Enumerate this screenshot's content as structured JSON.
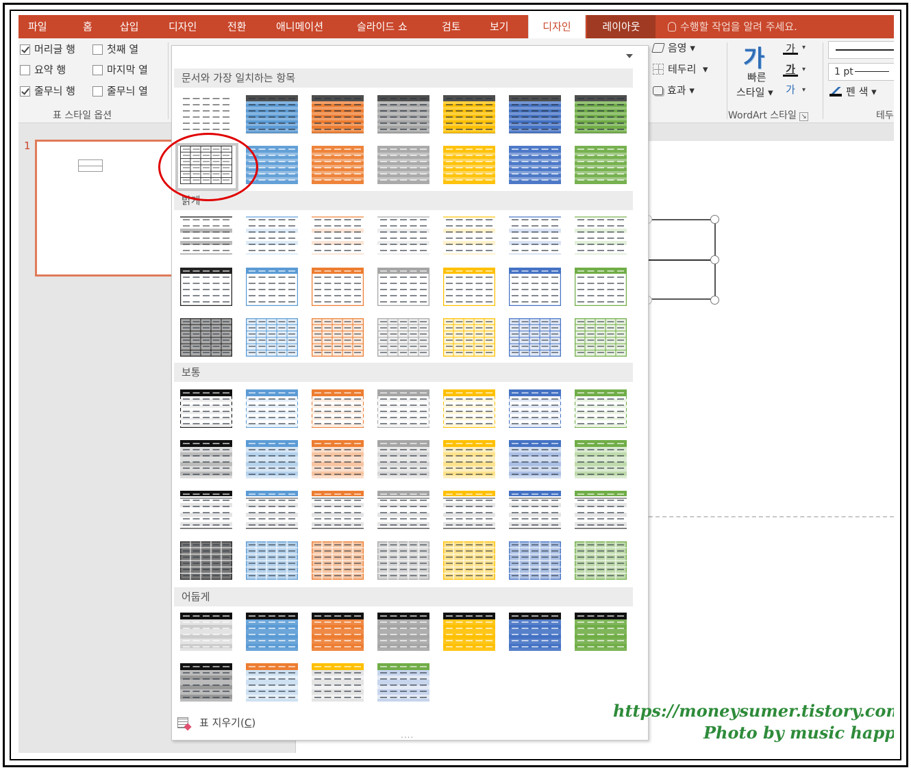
{
  "tabs": [
    {
      "label": "파일"
    },
    {
      "label": "홈"
    },
    {
      "label": "삽입"
    },
    {
      "label": "디자인"
    },
    {
      "label": "전환"
    },
    {
      "label": "애니메이션"
    },
    {
      "label": "슬라이드 쇼"
    },
    {
      "label": "검토"
    },
    {
      "label": "보기"
    },
    {
      "label": "디자인"
    },
    {
      "label": "레이아웃"
    }
  ],
  "tell_me": "수행할 작업을 알려 주세요.",
  "style_options": {
    "group_label": "표 스타일 옵션",
    "items": [
      {
        "label": "머리글 행",
        "checked": true
      },
      {
        "label": "첫째 열",
        "checked": false
      },
      {
        "label": "요약 행",
        "checked": false
      },
      {
        "label": "마지막 열",
        "checked": false
      },
      {
        "label": "줄무늬 행",
        "checked": true
      },
      {
        "label": "줄무늬 열",
        "checked": false
      }
    ]
  },
  "ribbon_right": {
    "shading": "음영",
    "borders": "테두리",
    "effects": "효과",
    "quick_styles_line1": "빠른",
    "quick_styles_line2": "스타일",
    "wordart_group": "WordArt 스타일",
    "pen_weight": "1 pt",
    "pen_color": "펜 색",
    "draw_group": "테두",
    "quick_glyph": "가"
  },
  "thumbnail_number": "1",
  "gallery": {
    "sections": [
      {
        "label": "문서와 가장 일치하는 항목"
      },
      {
        "label": "밝게"
      },
      {
        "label": "보통"
      },
      {
        "label": "어둡게"
      }
    ],
    "clear_prefix": "표 지우기(",
    "clear_key": "C",
    "clear_suffix": ")",
    "grip": "....",
    "palette": [
      "#444444",
      "#5b9bd5",
      "#ed7d31",
      "#a5a5a5",
      "#ffc000",
      "#4472c4",
      "#70ad47"
    ]
  },
  "watermark": {
    "line1": "https://moneysumer.tistory.com",
    "line2": "Photo by music happy"
  }
}
